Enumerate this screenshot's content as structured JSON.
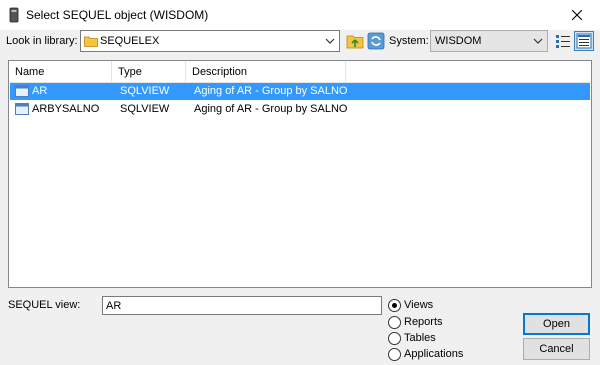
{
  "window": {
    "title": "Select SEQUEL object (WISDOM)"
  },
  "toolbar": {
    "library_label": "Look in library:",
    "library_value": "SEQUELEX",
    "system_label": "System:",
    "system_value": "WISDOM"
  },
  "list": {
    "columns": [
      "Name",
      "Type",
      "Description"
    ],
    "rows": [
      {
        "name": "AR",
        "type": "SQLVIEW",
        "description": "Aging of AR - Group by SALNO",
        "selected": true
      },
      {
        "name": "ARBYSALNO",
        "type": "SQLVIEW",
        "description": "Aging of AR - Group by SALNO",
        "selected": false
      }
    ]
  },
  "form": {
    "view_label": "SEQUEL view:",
    "view_value": "AR"
  },
  "radios": [
    {
      "label": "Views",
      "checked": true
    },
    {
      "label": "Reports",
      "checked": false
    },
    {
      "label": "Tables",
      "checked": false
    },
    {
      "label": "Applications",
      "checked": false
    }
  ],
  "buttons": {
    "open": "Open",
    "cancel": "Cancel"
  },
  "colors": {
    "selection": "#3399ff",
    "folder": "#f5c542",
    "accent": "#0078d7"
  }
}
